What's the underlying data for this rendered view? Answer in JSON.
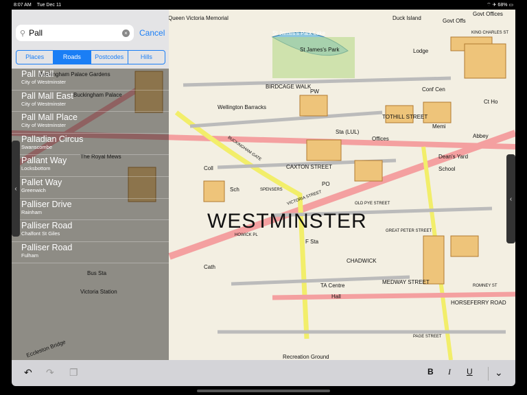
{
  "status": {
    "time": "8:07 AM",
    "date": "Tue Dec 11",
    "battery": "68%"
  },
  "search": {
    "value": "Pall",
    "cancel": "Cancel"
  },
  "segments": [
    {
      "label": "Places"
    },
    {
      "label": "Roads"
    },
    {
      "label": "Postcodes"
    },
    {
      "label": "Hills"
    }
  ],
  "results": [
    {
      "title": "Pall Mall",
      "subtitle": "City of Westminster"
    },
    {
      "title": "Pall Mall East",
      "subtitle": "City of Westminster"
    },
    {
      "title": "Pall Mall Place",
      "subtitle": "City of Westminster"
    },
    {
      "title": "Palladian Circus",
      "subtitle": "Swanscombe"
    },
    {
      "title": "Pallant Way",
      "subtitle": "Locksbottom"
    },
    {
      "title": "Pallet Way",
      "subtitle": "Greenwich"
    },
    {
      "title": "Palliser Drive",
      "subtitle": "Rainham"
    },
    {
      "title": "Palliser Road",
      "subtitle": "Chalfont St Giles"
    },
    {
      "title": "Palliser Road",
      "subtitle": "Fulham"
    }
  ],
  "map": {
    "labels": [
      "Queen Victoria Memorial",
      "Duck Island",
      "Govt Offs",
      "Govt Offices",
      "St James's Park Lake",
      "St James's Park",
      "Lodge",
      "KING CHARLES ST",
      "Buckingham Palace Gardens",
      "Buckingham Palace",
      "BIRDCAGE WALK",
      "Wellington Barracks",
      "PW",
      "Conf Cen",
      "Ct Ho",
      "TOTHILL STREET",
      "Memi",
      "Abbey",
      "Sta (LUL)",
      "Offices",
      "Dean's Yard",
      "School",
      "The Royal Mews",
      "Coll",
      "Sch",
      "CAXTON STREET",
      "BUCKINGHAM GATE",
      "SPENSERS",
      "PO",
      "VICTORIA STREET",
      "WESTMINSTER",
      "OLD PYE STREET",
      "GREAT PETER STREET",
      "HOWICK PL",
      "F Sta",
      "Cath",
      "CHADWICK",
      "TA Centre",
      "Hall",
      "MEDWAY STREET",
      "HORSEFERRY ROAD",
      "ROMNEY ST",
      "Bus Sta",
      "Victoria Station",
      "Eccleston Bridge",
      "PAGE STREET",
      "Recreation Ground"
    ]
  },
  "toolbar": {
    "bold": "B",
    "italic": "I",
    "underline": "U"
  }
}
